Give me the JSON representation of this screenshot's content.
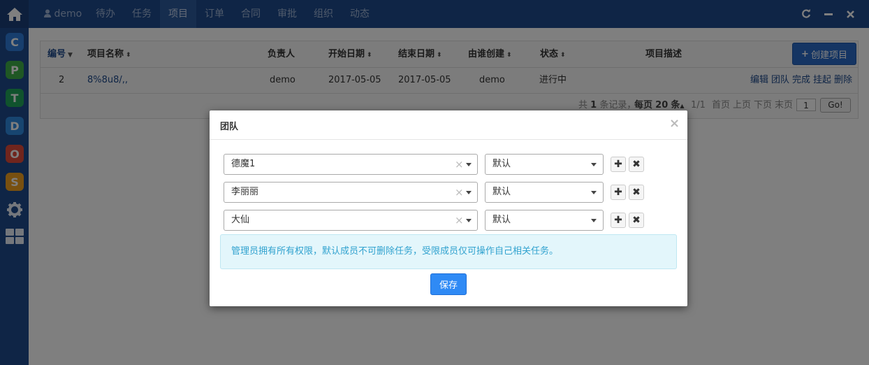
{
  "nav": {
    "user": "demo",
    "items": [
      "待办",
      "任务",
      "项目",
      "订单",
      "合同",
      "审批",
      "组织",
      "动态"
    ],
    "active": "项目"
  },
  "sidebar": {
    "apps": [
      {
        "letter": "C",
        "color": "#2f7ddb"
      },
      {
        "letter": "P",
        "color": "#3fae49"
      },
      {
        "letter": "T",
        "color": "#21a65b"
      },
      {
        "letter": "D",
        "color": "#2f8ae0"
      },
      {
        "letter": "O",
        "color": "#e04a3a"
      },
      {
        "letter": "S",
        "color": "#f0a020"
      }
    ]
  },
  "table": {
    "headers": {
      "id": "编号",
      "name": "项目名称",
      "owner": "负责人",
      "start": "开始日期",
      "end": "结束日期",
      "creator": "由谁创建",
      "status": "状态",
      "desc": "项目描述"
    },
    "create_label": "创建项目",
    "rows": [
      {
        "id": "2",
        "name": "8%8u8/,,",
        "owner": "demo",
        "start": "2017-05-05",
        "end": "2017-05-05",
        "creator": "demo",
        "status": "进行中",
        "actions": [
          "编辑",
          "团队",
          "完成",
          "挂起",
          "删除"
        ]
      }
    ]
  },
  "pager": {
    "summary_prefix": "共",
    "count": "1",
    "summary_mid": "条记录，",
    "per_page_label": "每页",
    "per_page": "20",
    "per_page_suffix": "条",
    "pages": "1/1",
    "first": "首页",
    "prev": "上页",
    "next": "下页",
    "last": "末页",
    "page_value": "1",
    "go": "Go!"
  },
  "modal": {
    "title": "团队",
    "members": [
      {
        "name": "德魔1",
        "role": "默认"
      },
      {
        "name": "李丽丽",
        "role": "默认"
      },
      {
        "name": "大仙",
        "role": "默认"
      }
    ],
    "info": "管理员拥有所有权限，默认成员不可删除任务，受限成员仅可操作自己相关任务。",
    "save": "保存"
  },
  "colors": {
    "navbar": "#1e4a8c",
    "primary": "#2f8af5",
    "info_bg": "#e3f6fb",
    "info_text": "#31a2cf"
  }
}
